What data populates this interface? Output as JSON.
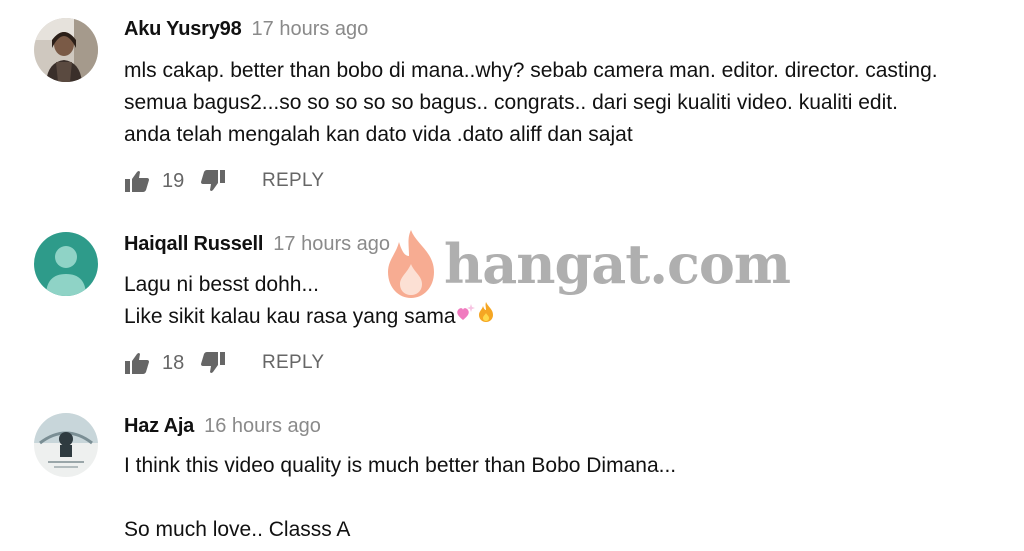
{
  "comments": [
    {
      "author": "Aku Yusry98",
      "time": "17 hours ago",
      "lines": [
        "mls cakap. better than bobo di mana..why? sebab camera man. editor. director. casting.",
        "semua bagus2...so so so so so bagus.. congrats.. dari segi kualiti video. kualiti edit.",
        "anda telah mengalah kan dato vida .dato aliff dan sajat"
      ],
      "likes": "19",
      "reply_label": "REPLY"
    },
    {
      "author": "Haiqall Russell",
      "time": "17 hours ago",
      "lines": [
        "Lagu ni besst dohh...",
        "Like sikit kalau kau rasa yang sama"
      ],
      "emojis": [
        "sparkling-heart",
        "fire"
      ],
      "likes": "18",
      "reply_label": "REPLY"
    },
    {
      "author": "Haz Aja",
      "time": "16 hours ago",
      "lines": [
        "I think this video quality is much better than Bobo Dimana...",
        "",
        "So much love..  Classs A"
      ]
    }
  ],
  "watermark": {
    "text": "hangat.com",
    "icon": "flame-icon"
  },
  "colors": {
    "author": "#111111",
    "timestamp": "#8a8a8a",
    "action": "#666666",
    "default_avatar_bg": "#2e9b8a",
    "watermark": "#6e6e6e",
    "flame": "#f26a3a"
  }
}
